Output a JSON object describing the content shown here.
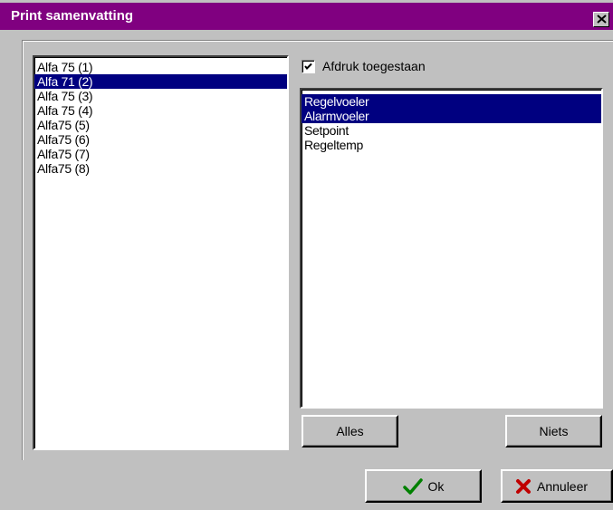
{
  "window": {
    "title": "Print samenvatting"
  },
  "left_list": {
    "items": [
      "Alfa 75 (1)",
      "Alfa 71 (2)",
      "Alfa 75 (3)",
      "Alfa 75 (4)",
      "Alfa75 (5)",
      "Alfa75 (6)",
      "Alfa75 (7)",
      "Alfa75 (8)"
    ],
    "selected_index": 1
  },
  "print_allowed": {
    "label": "Afdruk toegestaan",
    "checked": true
  },
  "right_list": {
    "items": [
      "Regelvoeler",
      "Alarmvoeler",
      "Setpoint",
      "Regeltemp"
    ],
    "selected": [
      0,
      1
    ]
  },
  "buttons": {
    "all_label": "Alles",
    "none_label": "Niets",
    "ok_label": "Ok",
    "cancel_label": "Annuleer"
  },
  "icons": {
    "close": "close-icon",
    "check": "checkmark-icon",
    "ok": "green-check-icon",
    "cancel": "red-x-icon"
  },
  "colors": {
    "titlebar": "#800080",
    "selection": "#000080",
    "dialog_bg": "#c0c0c0",
    "ok_icon": "#008000",
    "cancel_icon": "#c00000"
  }
}
